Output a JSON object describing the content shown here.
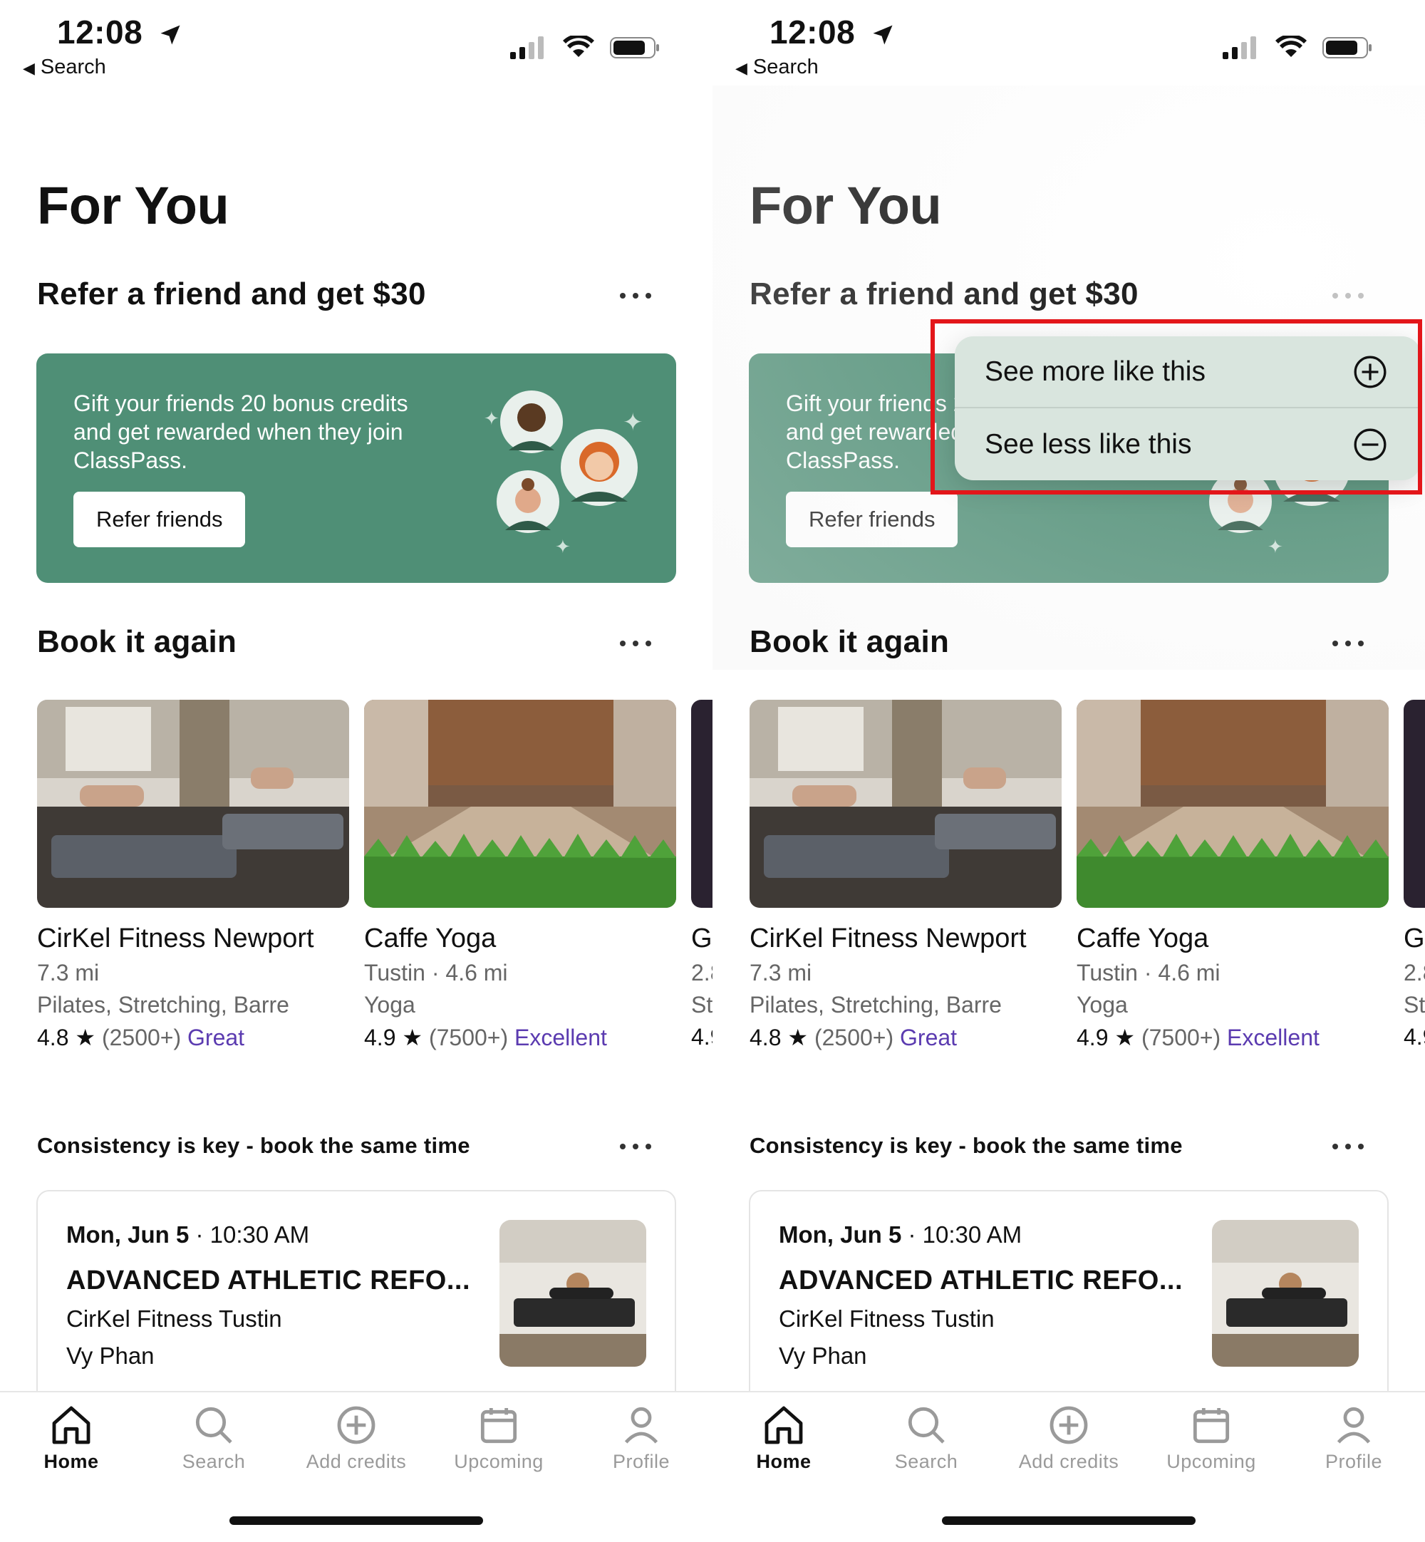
{
  "status": {
    "time": "12:08",
    "back_label": "Search"
  },
  "page": {
    "title": "For You"
  },
  "refer": {
    "title": "Refer a friend and get $30",
    "body": "Gift your friends 20 bonus credits and get rewarded when they join ClassPass.",
    "button": "Refer friends",
    "card_color": "#4f8f76"
  },
  "book_again": {
    "title": "Book it again",
    "studios": [
      {
        "name": "CirKel Fitness Newport",
        "distance": "7.3 mi",
        "categories": "Pilates, Stretching, Barre",
        "rating": "4.8",
        "star": "★",
        "count": "(2500+)",
        "grade": "Great"
      },
      {
        "name": "Caffe Yoga",
        "distance": "Tustin · 4.6 mi",
        "categories": "Yoga",
        "rating": "4.9",
        "star": "★",
        "count": "(7500+)",
        "grade": "Excellent"
      },
      {
        "name": "G",
        "distance": "2.8",
        "categories": "St",
        "rating": "4.9",
        "star": "",
        "count": "",
        "grade": ""
      }
    ]
  },
  "consistency": {
    "title": "Consistency is key - book the same time",
    "class": {
      "date": "Mon, Jun 5",
      "time": " · 10:30 AM",
      "name": "ADVANCED ATHLETIC REFO...",
      "studio": "CirKel Fitness Tustin",
      "instructor": "Vy Phan"
    }
  },
  "tabs": [
    {
      "label": "Home",
      "icon": "home-icon",
      "active": true
    },
    {
      "label": "Search",
      "icon": "search-icon",
      "active": false
    },
    {
      "label": "Add credits",
      "icon": "add-circle-icon",
      "active": false
    },
    {
      "label": "Upcoming",
      "icon": "calendar-icon",
      "active": false
    },
    {
      "label": "Profile",
      "icon": "person-icon",
      "active": false
    }
  ],
  "menu": {
    "more": "See more like this",
    "less": "See less like this",
    "highlight_color": "#e3161a"
  },
  "colors": {
    "accent_purple": "#5b3bb0",
    "menu_bg": "#d9e5de"
  }
}
